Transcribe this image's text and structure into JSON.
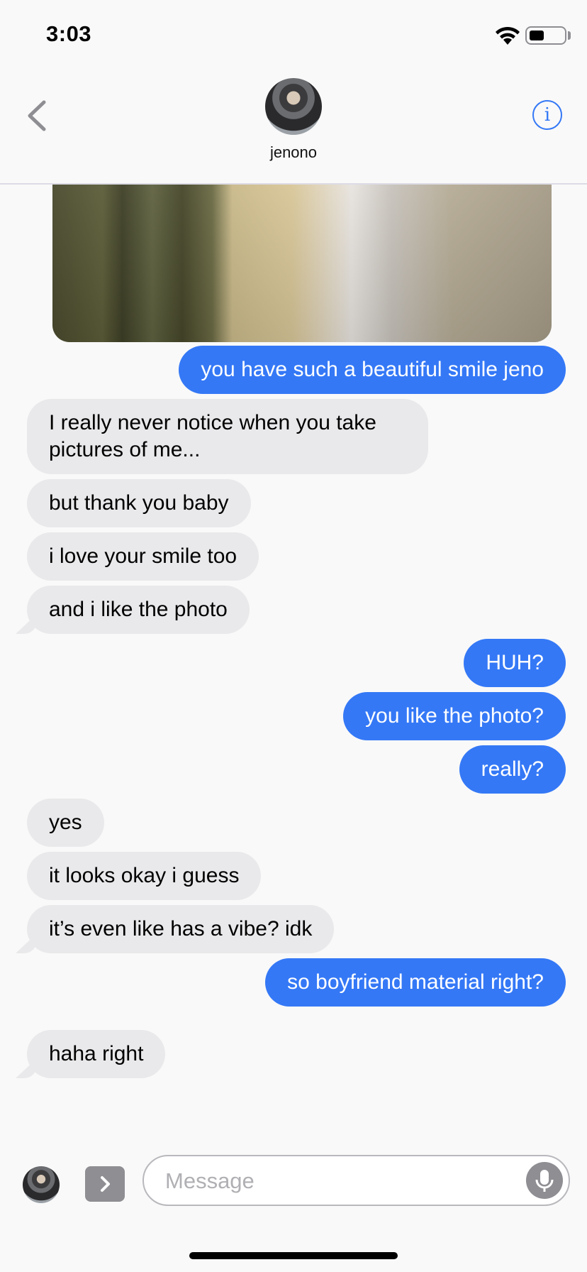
{
  "status_bar": {
    "time": "3:03"
  },
  "header": {
    "contact_name": "jenono",
    "info_label": "i"
  },
  "messages": [
    {
      "dir": "out",
      "text": "you have such a beautiful smile jeno"
    },
    {
      "dir": "in",
      "text": "I really never notice when you take pictures of me..."
    },
    {
      "dir": "in",
      "text": "but thank you baby"
    },
    {
      "dir": "in",
      "text": "i love your smile too"
    },
    {
      "dir": "in",
      "text": "and i like the photo"
    },
    {
      "dir": "out",
      "text": "HUH?"
    },
    {
      "dir": "out",
      "text": "you like the photo?"
    },
    {
      "dir": "out",
      "text": "really?"
    },
    {
      "dir": "in",
      "text": "yes"
    },
    {
      "dir": "in",
      "text": "it looks okay i guess"
    },
    {
      "dir": "in",
      "text": "it’s even like has a vibe? idk"
    },
    {
      "dir": "out",
      "text": "so boyfriend material right?"
    },
    {
      "dir": "in",
      "text": "haha right"
    }
  ],
  "composer": {
    "placeholder": "Message"
  },
  "colors": {
    "accent": "#3478f6",
    "incoming_bubble": "#e9e9eb",
    "background": "#f9f9f9"
  },
  "icons": [
    "wifi-icon",
    "battery-icon",
    "back-chevron-icon",
    "info-icon",
    "apps-chevron-icon",
    "microphone-icon"
  ]
}
